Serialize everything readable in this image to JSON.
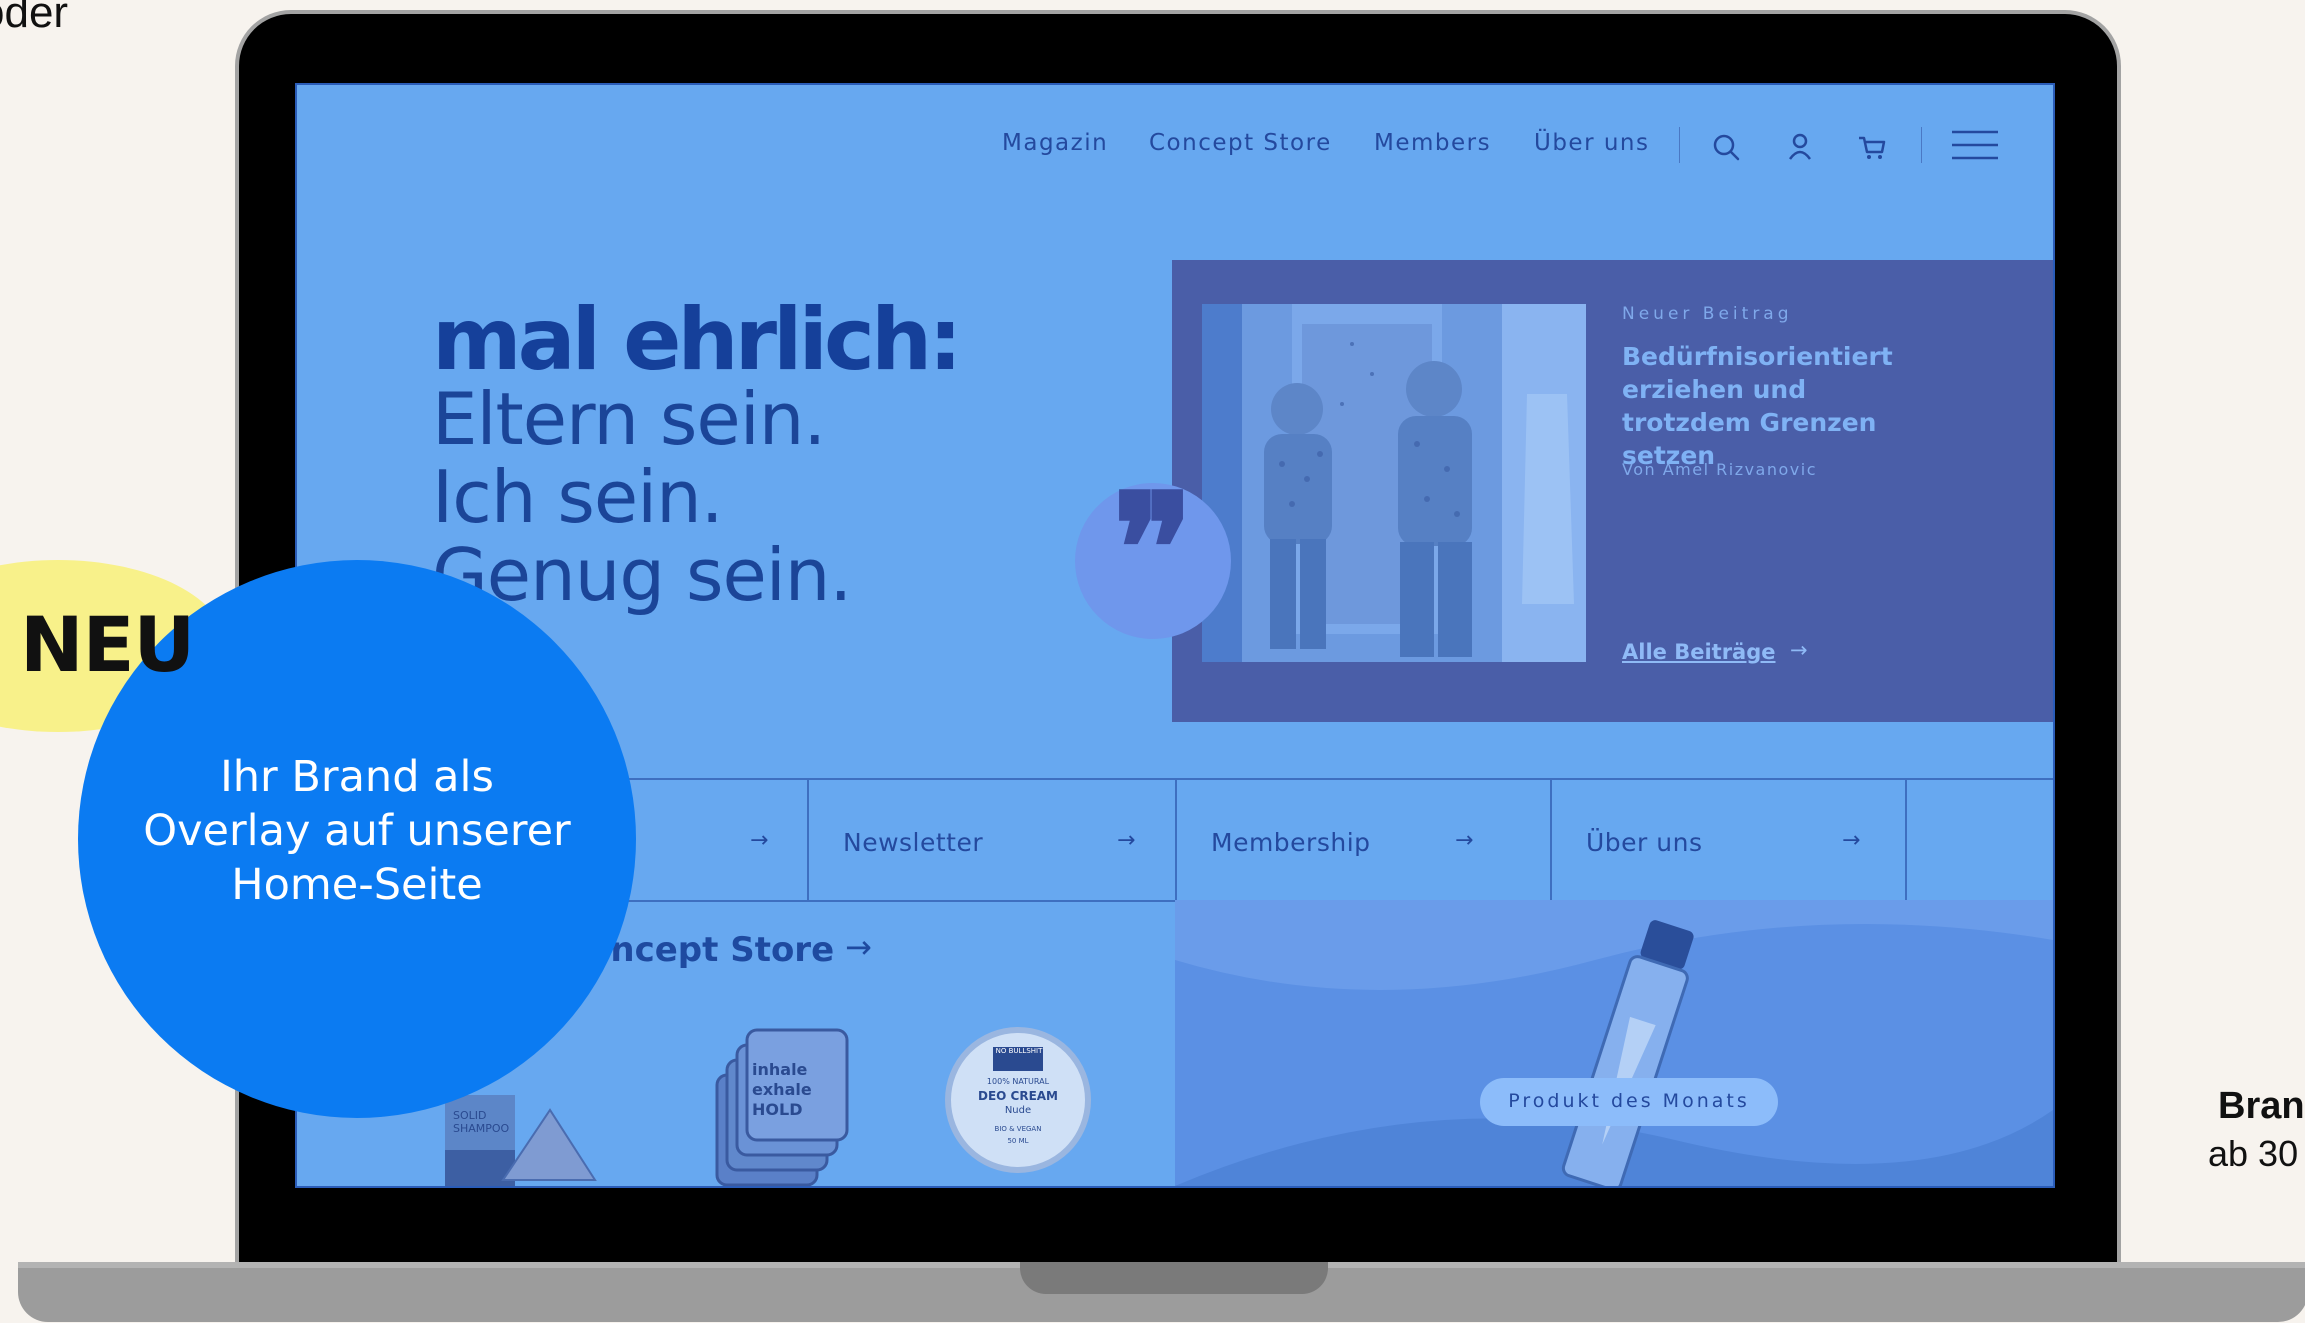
{
  "outside": {
    "oder": "oder",
    "brand_right": "Bran",
    "price_right": "ab 30"
  },
  "nav": {
    "links": [
      "Magazin",
      "Concept Store",
      "Members",
      "Über uns"
    ],
    "icons": [
      "search-icon",
      "user-icon",
      "cart-icon",
      "menu-icon"
    ]
  },
  "hero": {
    "bold": "mal ehrlich:",
    "lines": [
      "Eltern sein.",
      "Ich sein.",
      "Genug sein."
    ]
  },
  "post": {
    "kicker": "Neuer Beitrag",
    "title": "Bedürfnisorientiert erziehen und trotzdem Grenzen setzen",
    "author": "Von Amel Rizvanovic",
    "all_label": "Alle Beiträge",
    "arrow": "→"
  },
  "quote_glyph": "❞",
  "tiles": [
    {
      "label": "",
      "arrow": "→"
    },
    {
      "label": "Newsletter",
      "arrow": "→"
    },
    {
      "label": "Membership",
      "arrow": "→"
    },
    {
      "label": "Über uns",
      "arrow": "→"
    }
  ],
  "concept_store": {
    "title": "oncept Store",
    "arrow": "→",
    "products": [
      {
        "label": "SOLID SHAMPOO"
      },
      {
        "label": "inhale exhale HOLD"
      },
      {
        "brand": "NO BULLSHIT",
        "line1": "100% NATURAL",
        "line2": "DEO CREAM",
        "line3": "Nude",
        "line4": "BIO & VEGAN",
        "line5": "50 ML"
      }
    ]
  },
  "product_month": {
    "label": "Produkt des Monats"
  },
  "overlay": {
    "neu": "NEU",
    "circle_text": [
      "Ihr Brand als",
      "Overlay auf unserer",
      "Home-Seite"
    ]
  },
  "colors": {
    "screen_bg": "#67a8f0",
    "post_bg": "#4a5ea8",
    "overlay_blue": "#0b7bf2",
    "neu_yellow": "#f8f18a"
  }
}
